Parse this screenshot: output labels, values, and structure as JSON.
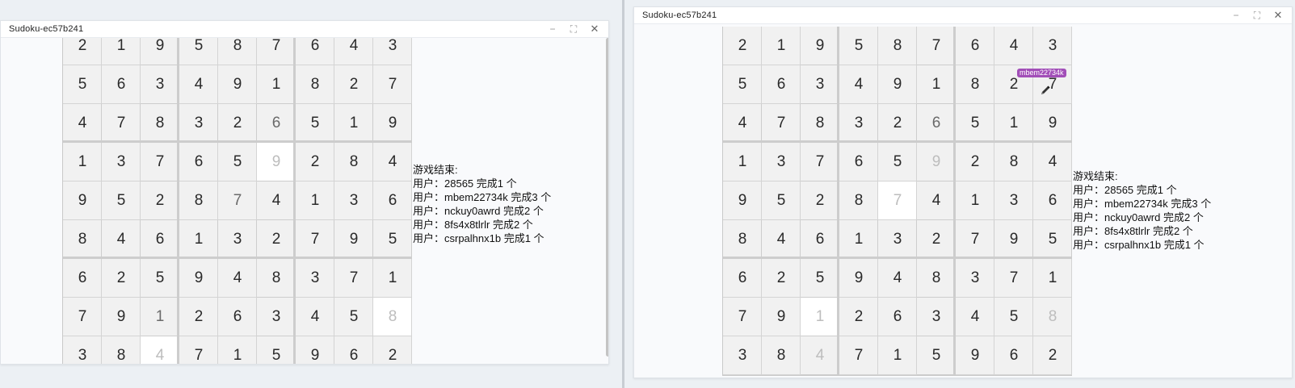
{
  "left_window": {
    "title": "Sudoku-ec57b241",
    "controls": {
      "minimize": "−",
      "maximize": "⛶",
      "close": "✕"
    }
  },
  "right_window": {
    "title": "Sudoku-ec57b241",
    "controls": {
      "minimize": "−",
      "maximize": "⛶",
      "close": "✕"
    }
  },
  "left_board": {
    "cells": [
      [
        "2",
        "1",
        "9",
        "5",
        "8",
        "7",
        "6",
        "4",
        "3"
      ],
      [
        "5",
        "6",
        "3",
        "4",
        "9",
        "1",
        "8",
        "2",
        "7"
      ],
      [
        "4",
        "7",
        "8",
        "3",
        "2",
        "6",
        "5",
        "1",
        "9"
      ],
      [
        "1",
        "3",
        "7",
        "6",
        "5",
        "9",
        "2",
        "8",
        "4"
      ],
      [
        "9",
        "5",
        "2",
        "8",
        "7",
        "4",
        "1",
        "3",
        "6"
      ],
      [
        "8",
        "4",
        "6",
        "1",
        "3",
        "2",
        "7",
        "9",
        "5"
      ],
      [
        "6",
        "2",
        "5",
        "9",
        "4",
        "8",
        "3",
        "7",
        "1"
      ],
      [
        "7",
        "9",
        "1",
        "2",
        "6",
        "3",
        "4",
        "5",
        "8"
      ],
      [
        "3",
        "8",
        "4",
        "7",
        "1",
        "5",
        "9",
        "6",
        "2"
      ]
    ],
    "filled": [
      [
        2,
        5
      ],
      [
        4,
        4
      ],
      [
        7,
        2
      ]
    ],
    "highlighted": [
      [
        3,
        5
      ],
      [
        7,
        8
      ],
      [
        8,
        2
      ]
    ]
  },
  "right_board": {
    "cells": [
      [
        "2",
        "1",
        "9",
        "5",
        "8",
        "7",
        "6",
        "4",
        "3"
      ],
      [
        "5",
        "6",
        "3",
        "4",
        "9",
        "1",
        "8",
        "2",
        "7"
      ],
      [
        "4",
        "7",
        "8",
        "3",
        "2",
        "6",
        "5",
        "1",
        "9"
      ],
      [
        "1",
        "3",
        "7",
        "6",
        "5",
        "9",
        "2",
        "8",
        "4"
      ],
      [
        "9",
        "5",
        "2",
        "8",
        "7",
        "4",
        "1",
        "3",
        "6"
      ],
      [
        "8",
        "4",
        "6",
        "1",
        "3",
        "2",
        "7",
        "9",
        "5"
      ],
      [
        "6",
        "2",
        "5",
        "9",
        "4",
        "8",
        "3",
        "7",
        "1"
      ],
      [
        "7",
        "9",
        "1",
        "2",
        "6",
        "3",
        "4",
        "5",
        "8"
      ],
      [
        "3",
        "8",
        "4",
        "7",
        "1",
        "5",
        "9",
        "6",
        "2"
      ]
    ],
    "filled": [
      [
        2,
        5
      ],
      [
        7,
        2
      ]
    ],
    "highlighted": [
      [
        4,
        4
      ],
      [
        7,
        2
      ]
    ],
    "faded": [
      [
        3,
        5
      ],
      [
        7,
        8
      ],
      [
        8,
        2
      ]
    ]
  },
  "results": {
    "heading": "游戏结束:",
    "lines": [
      "用户：28565 完成1 个",
      "用户：mbem22734k 完成3 个",
      "用户：nckuy0awrd 完成2 个",
      "用户：8fs4x8tlrlr 完成2 个",
      "用户：csrpalhnx1b 完成1 个"
    ]
  },
  "cursor": {
    "label": "mbem22734k",
    "color": "#a24fb8",
    "icon": "pencil-icon"
  }
}
